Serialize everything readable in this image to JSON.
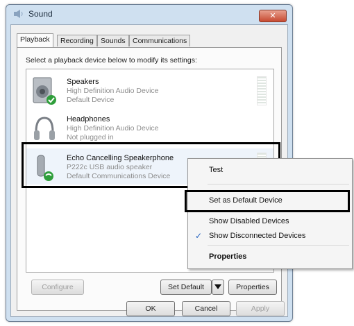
{
  "window": {
    "title": "Sound",
    "close_glyph": "✕"
  },
  "tabs": [
    {
      "label": "Playback",
      "active": true
    },
    {
      "label": "Recording",
      "active": false
    },
    {
      "label": "Sounds",
      "active": false
    },
    {
      "label": "Communications",
      "active": false
    }
  ],
  "instruction": "Select a playback device below to modify its settings:",
  "devices": [
    {
      "name": "Speakers",
      "line1": "High Definition Audio Device",
      "line2": "Default Device",
      "status": "default",
      "icon": "speaker-icon"
    },
    {
      "name": "Headphones",
      "line1": "High Definition Audio Device",
      "line2": "Not plugged in",
      "status": "unplugged",
      "icon": "headphones-icon"
    },
    {
      "name": "Echo Cancelling Speakerphone",
      "line1": "P222c USB audio speaker",
      "line2": "Default Communications Device",
      "status": "default-communications",
      "icon": "telephone-icon"
    }
  ],
  "buttons": {
    "configure": "Configure",
    "set_default": "Set Default",
    "properties": "Properties",
    "ok": "OK",
    "cancel": "Cancel",
    "apply": "Apply"
  },
  "context_menu": {
    "items": [
      {
        "label": "Test",
        "checked": false
      },
      {
        "label": "Set as Default Device",
        "checked": false
      },
      {
        "label": "Show Disabled Devices",
        "checked": false
      },
      {
        "label": "Show Disconnected Devices",
        "checked": true
      },
      {
        "label": "Properties",
        "checked": false
      }
    ],
    "check_glyph": "✓"
  },
  "colors": {
    "accent": "#1f5fbf",
    "default_badge": "#2f9e3b",
    "highlight_border": "#000000"
  }
}
